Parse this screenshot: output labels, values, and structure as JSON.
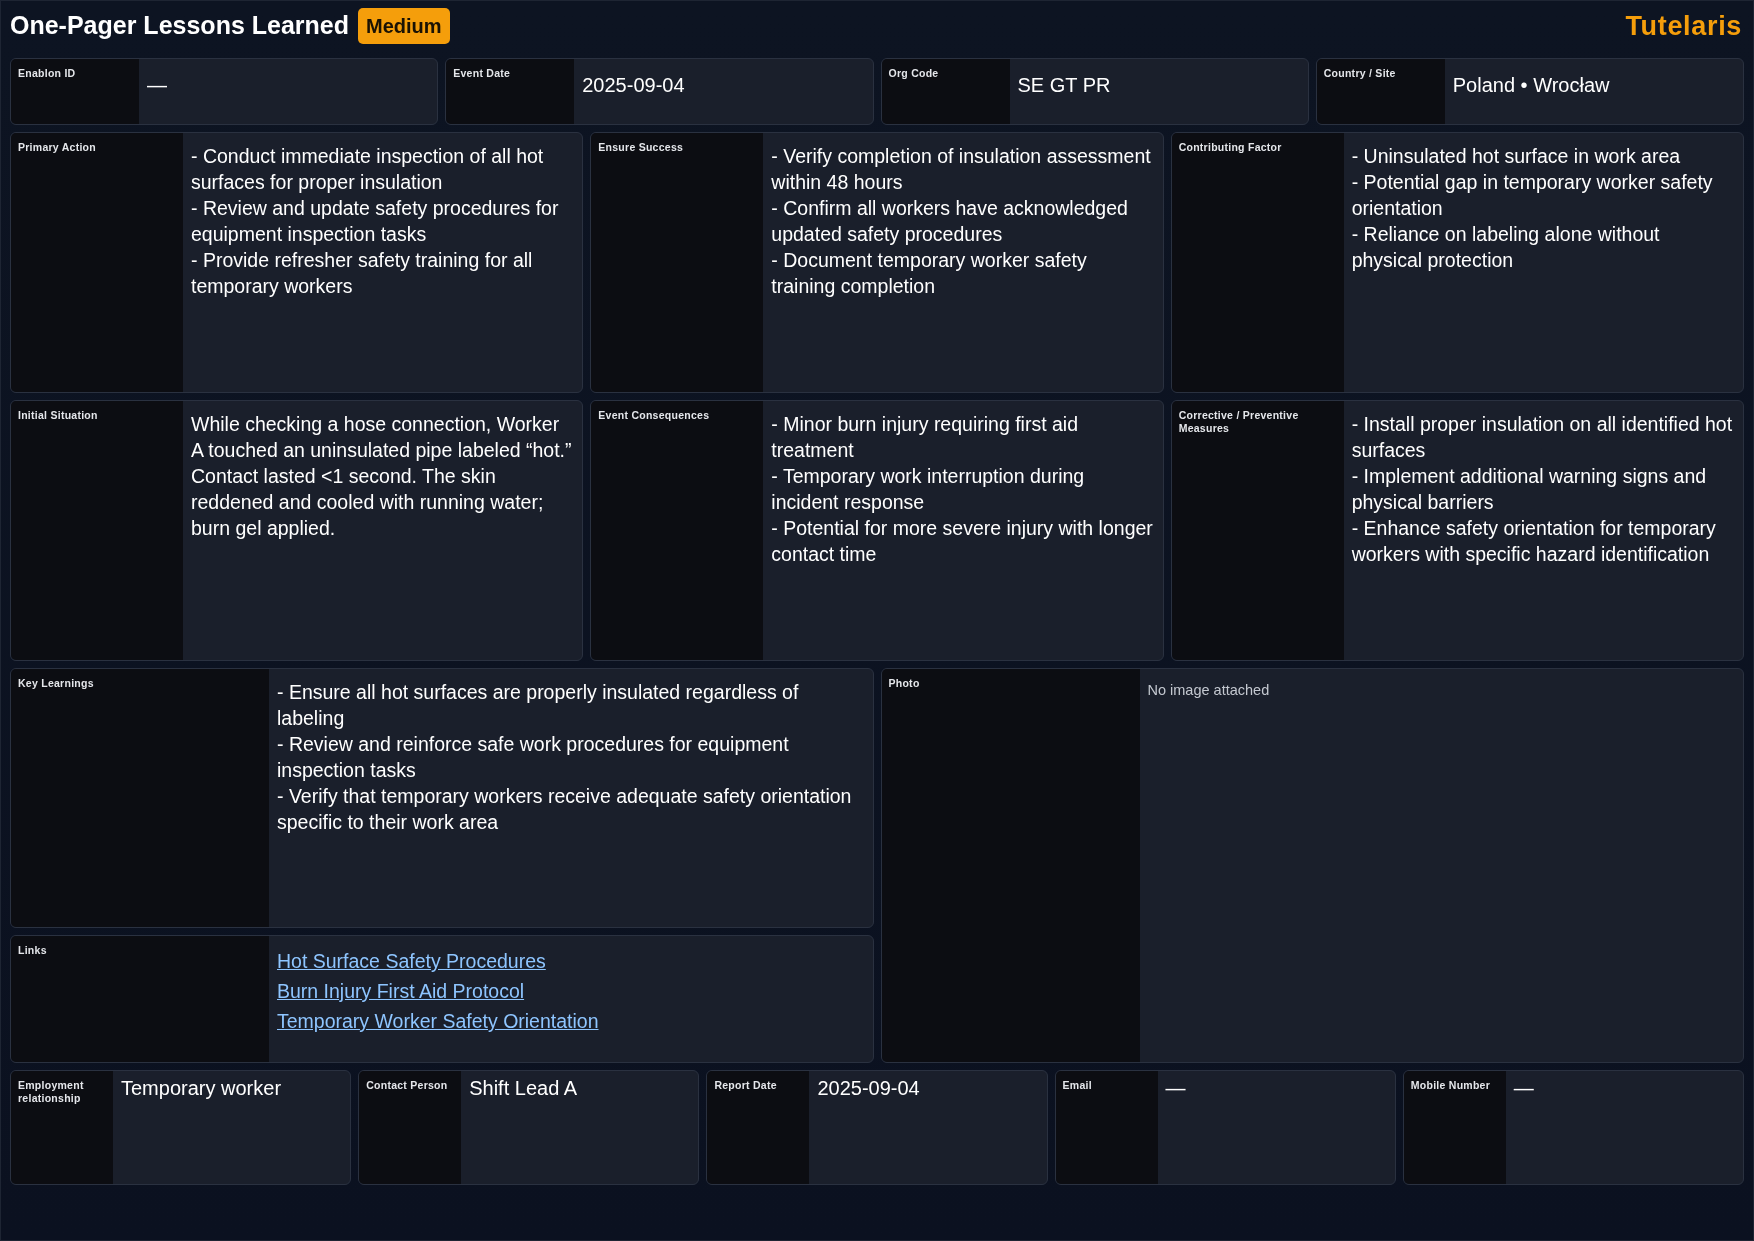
{
  "header": {
    "title": "One-Pager Lessons Learned",
    "severity": "Medium",
    "brand": "Tutelaris"
  },
  "top_fields": [
    {
      "label": "Enablon ID",
      "value": "—"
    },
    {
      "label": "Event Date",
      "value": "2025-09-04"
    },
    {
      "label": "Org Code",
      "value": "SE GT PR"
    },
    {
      "label": "Country / Site",
      "value": "Poland • Wrocław"
    }
  ],
  "sections": [
    {
      "label": "Primary Action",
      "lines": [
        "- Conduct immediate inspection of all hot surfaces for proper insulation",
        "- Review and update safety procedures for equipment inspection tasks",
        "- Provide refresher safety training for all temporary workers"
      ]
    },
    {
      "label": "Ensure Success",
      "lines": [
        "- Verify completion of insulation assessment within 48 hours",
        "- Confirm all workers have acknowledged updated safety procedures",
        "- Document temporary worker safety training completion"
      ]
    },
    {
      "label": "Contributing Factor",
      "lines": [
        "- Uninsulated hot surface in work area",
        "- Potential gap in temporary worker safety orientation",
        "- Reliance on labeling alone without physical protection"
      ]
    },
    {
      "label": "Initial Situation",
      "lines": [
        "While checking a hose connection, Worker A touched an uninsulated pipe labeled “hot.” Contact lasted <1 second. The skin reddened and cooled with running water; burn gel applied."
      ]
    },
    {
      "label": "Event Consequences",
      "lines": [
        "- Minor burn injury requiring first aid treatment",
        "- Temporary work interruption during incident response",
        "- Potential for more severe injury with longer contact time"
      ]
    },
    {
      "label": "Corrective / Preventive Measures",
      "lines": [
        "- Install proper insulation on all identified hot surfaces",
        "- Implement additional warning signs and physical barriers",
        "- Enhance safety orientation for temporary workers with specific hazard identification"
      ]
    }
  ],
  "key_learnings": {
    "label": "Key Learnings",
    "lines": [
      "- Ensure all hot surfaces are properly insulated regardless of labeling",
      "- Review and reinforce safe work procedures for equipment inspection tasks",
      "- Verify that temporary workers receive adequate safety orientation specific to their work area"
    ]
  },
  "links": {
    "label": "Links",
    "items": [
      "Hot Surface Safety Procedures",
      "Burn Injury First Aid Protocol",
      "Temporary Worker Safety Orientation"
    ]
  },
  "photo": {
    "label": "Photo",
    "empty_text": "No image attached"
  },
  "bottom_fields": [
    {
      "label": "Employment relationship",
      "value": "Temporary worker"
    },
    {
      "label": "Contact Person",
      "value": "Shift Lead A"
    },
    {
      "label": "Report Date",
      "value": "2025-09-04"
    },
    {
      "label": "Email",
      "value": "—"
    },
    {
      "label": "Mobile Number",
      "value": "—"
    }
  ]
}
